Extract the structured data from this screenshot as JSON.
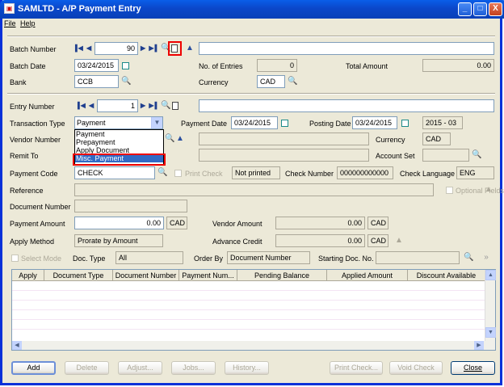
{
  "window": {
    "title": "SAMLTD - A/P Payment Entry",
    "min": "_",
    "max": "□",
    "close": "X"
  },
  "menu": {
    "file": "File",
    "help": "Help"
  },
  "batch": {
    "number_label": "Batch Number",
    "number": "90",
    "date_label": "Batch Date",
    "date": "03/24/2015",
    "entries_label": "No. of Entries",
    "entries": "0",
    "total_label": "Total Amount",
    "total": "0.00",
    "bank_label": "Bank",
    "bank": "CCB",
    "currency_label": "Currency",
    "currency": "CAD"
  },
  "entry": {
    "number_label": "Entry Number",
    "number": "1",
    "type_label": "Transaction Type",
    "type": "Payment",
    "type_options": [
      "Payment",
      "Prepayment",
      "Apply Document",
      "Misc. Payment"
    ],
    "payment_date_label": "Payment Date",
    "payment_date": "03/24/2015",
    "posting_date_label": "Posting Date",
    "posting_date": "03/24/2015",
    "period": "2015 - 03",
    "vendor_label": "Vendor Number",
    "currency_label": "Currency",
    "currency": "CAD",
    "remit_label": "Remit To",
    "account_set_label": "Account Set",
    "payment_code_label": "Payment Code",
    "payment_code": "CHECK",
    "print_check_label": "Print Check",
    "print_status": "Not printed",
    "check_number_label": "Check Number",
    "check_number": "000000000000",
    "check_language_label": "Check Language",
    "check_language": "ENG",
    "reference_label": "Reference",
    "optional_fields_label": "Optional Fields",
    "doc_number_label": "Document Number",
    "payment_amount_label": "Payment Amount",
    "payment_amount": "0.00",
    "payment_currency": "CAD",
    "vendor_amount_label": "Vendor Amount",
    "vendor_amount": "0.00",
    "vendor_currency": "CAD",
    "apply_method_label": "Apply Method",
    "apply_method": "Prorate by Amount",
    "advance_credit_label": "Advance Credit",
    "advance_credit": "0.00",
    "advance_currency": "CAD",
    "select_mode_label": "Select Mode",
    "doc_type_label": "Doc. Type",
    "doc_type": "All",
    "order_by_label": "Order By",
    "order_by": "Document Number",
    "starting_doc_label": "Starting Doc. No."
  },
  "grid": {
    "columns": [
      "Apply",
      "Document Type",
      "Document Number",
      "Payment Num...",
      "Pending Balance",
      "Applied Amount",
      "Discount Available"
    ]
  },
  "buttons": {
    "add": "Add",
    "delete": "Delete",
    "adjust": "Adjust...",
    "jobs": "Jobs...",
    "history": "History...",
    "print_check": "Print Check...",
    "void_check": "Void Check",
    "close": "Close"
  }
}
